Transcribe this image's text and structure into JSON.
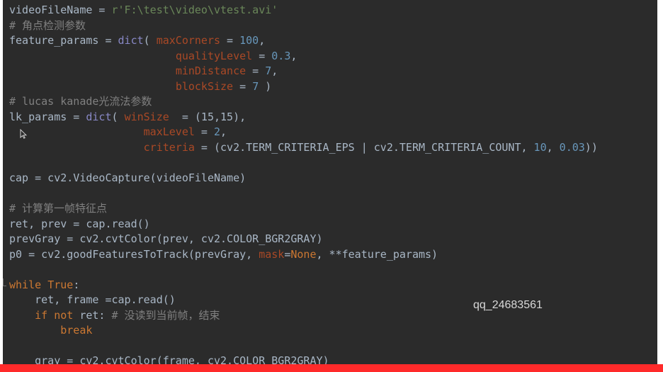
{
  "code_lines": [
    [
      [
        "t-op",
        "videoFileName = "
      ],
      [
        "t-str",
        "r'F:\\test\\video\\vtest.avi'"
      ]
    ],
    [
      [
        "t-comment",
        "# 角点检测参数"
      ]
    ],
    [
      [
        "t-op",
        "feature_params = "
      ],
      [
        "t-builtin",
        "dict"
      ],
      [
        "t-op",
        "( "
      ],
      [
        "t-param",
        "maxCorners"
      ],
      [
        "t-op",
        " = "
      ],
      [
        "t-num",
        "100"
      ],
      [
        "t-op",
        ","
      ]
    ],
    [
      [
        "t-op",
        "                          "
      ],
      [
        "t-param",
        "qualityLevel"
      ],
      [
        "t-op",
        " = "
      ],
      [
        "t-num",
        "0.3"
      ],
      [
        "t-op",
        ","
      ]
    ],
    [
      [
        "t-op",
        "                          "
      ],
      [
        "t-param",
        "minDistance"
      ],
      [
        "t-op",
        " = "
      ],
      [
        "t-num",
        "7"
      ],
      [
        "t-op",
        ","
      ]
    ],
    [
      [
        "t-op",
        "                          "
      ],
      [
        "t-param",
        "blockSize"
      ],
      [
        "t-op",
        " = "
      ],
      [
        "t-num",
        "7"
      ],
      [
        "t-op",
        " )"
      ]
    ],
    [
      [
        "t-comment",
        "# lucas kanade光流法参数"
      ]
    ],
    [
      [
        "t-op",
        "lk_params = "
      ],
      [
        "t-builtin",
        "dict"
      ],
      [
        "t-op",
        "( "
      ],
      [
        "t-param",
        "winSize"
      ],
      [
        "t-op",
        "  = (15,15),"
      ]
    ],
    [
      [
        "t-op",
        "                     "
      ],
      [
        "t-param",
        "maxLevel"
      ],
      [
        "t-op",
        " = "
      ],
      [
        "t-num",
        "2"
      ],
      [
        "t-op",
        ","
      ]
    ],
    [
      [
        "t-op",
        "                     "
      ],
      [
        "t-param",
        "criteria"
      ],
      [
        "t-op",
        " = (cv2.TERM_CRITERIA_EPS | cv2.TERM_CRITERIA_COUNT, "
      ],
      [
        "t-num",
        "10"
      ],
      [
        "t-op",
        ", "
      ],
      [
        "t-num",
        "0.03"
      ],
      [
        "t-op",
        "))"
      ]
    ],
    [],
    [
      [
        "t-op",
        "cap = cv2.VideoCapture(videoFileName)"
      ]
    ],
    [],
    [
      [
        "t-comment",
        "# 计算第一帧特征点"
      ]
    ],
    [
      [
        "t-op",
        "ret, prev = cap.read()"
      ]
    ],
    [
      [
        "t-op",
        "prevGray = cv2.cvtColor(prev, cv2.COLOR_BGR2GRAY)"
      ]
    ],
    [
      [
        "t-op",
        "p0 = cv2.goodFeaturesToTrack(prevGray, "
      ],
      [
        "t-param",
        "mask"
      ],
      [
        "t-op",
        "="
      ],
      [
        "t-kw",
        "None"
      ],
      [
        "t-op",
        ", **feature_params)"
      ]
    ],
    [],
    [
      [
        "t-kw",
        "while "
      ],
      [
        "t-kw",
        "True"
      ],
      [
        "t-op",
        ":"
      ]
    ],
    [
      [
        "t-op",
        "    ret, frame =cap.read()"
      ]
    ],
    [
      [
        "t-op",
        "    "
      ],
      [
        "t-kw",
        "if not "
      ],
      [
        "t-op",
        "ret: "
      ],
      [
        "t-comment",
        "# 没读到当前帧，结束"
      ]
    ],
    [
      [
        "t-op",
        "        "
      ],
      [
        "t-kw",
        "break"
      ]
    ],
    [],
    [
      [
        "t-op",
        "    gray = cv2.cvtColor(frame, cv2.COLOR_BGR2GRAY)"
      ]
    ]
  ],
  "watermark": "qq_24683561",
  "cursor_icon": "mouse-pointer-icon"
}
